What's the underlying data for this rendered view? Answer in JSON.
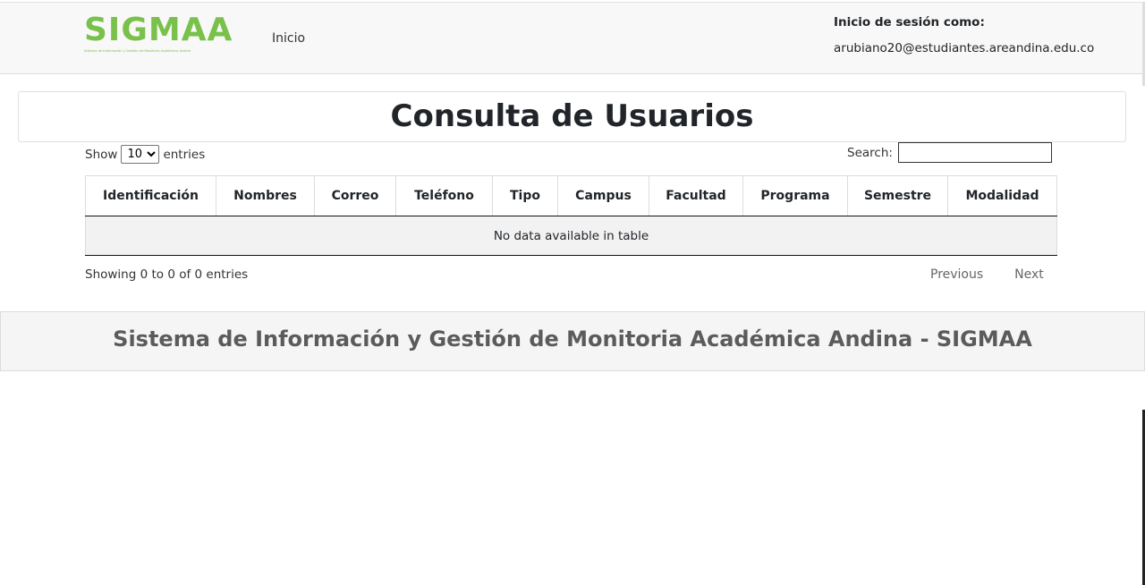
{
  "navbar": {
    "logo_text": "SIGMAA",
    "logo_subtitle": "Sistema de Información y Gestión de Monitoria Académica Andina",
    "home_link": "Inicio",
    "login_label": "Inicio de sesión como:",
    "login_email": "arubiano20@estudiantes.areandina.edu.co"
  },
  "main": {
    "title": "Consulta de Usuarios"
  },
  "table": {
    "show_label": "Show",
    "entries_label": "entries",
    "length_value": "10",
    "search_label": "Search:",
    "search_value": "",
    "columns": [
      "Identificación",
      "Nombres",
      "Correo",
      "Teléfono",
      "Tipo",
      "Campus",
      "Facultad",
      "Programa",
      "Semestre",
      "Modalidad"
    ],
    "empty_message": "No data available in table",
    "info": "Showing 0 to 0 of 0 entries",
    "previous_label": "Previous",
    "next_label": "Next"
  },
  "footer": {
    "text": "Sistema de Información y Gestión de Monitoria Académica Andina - SIGMAA"
  },
  "colors": {
    "brand_green": "#79c14a",
    "navbar_bg": "#f8f8f8",
    "footer_text": "#5b5b5b"
  }
}
